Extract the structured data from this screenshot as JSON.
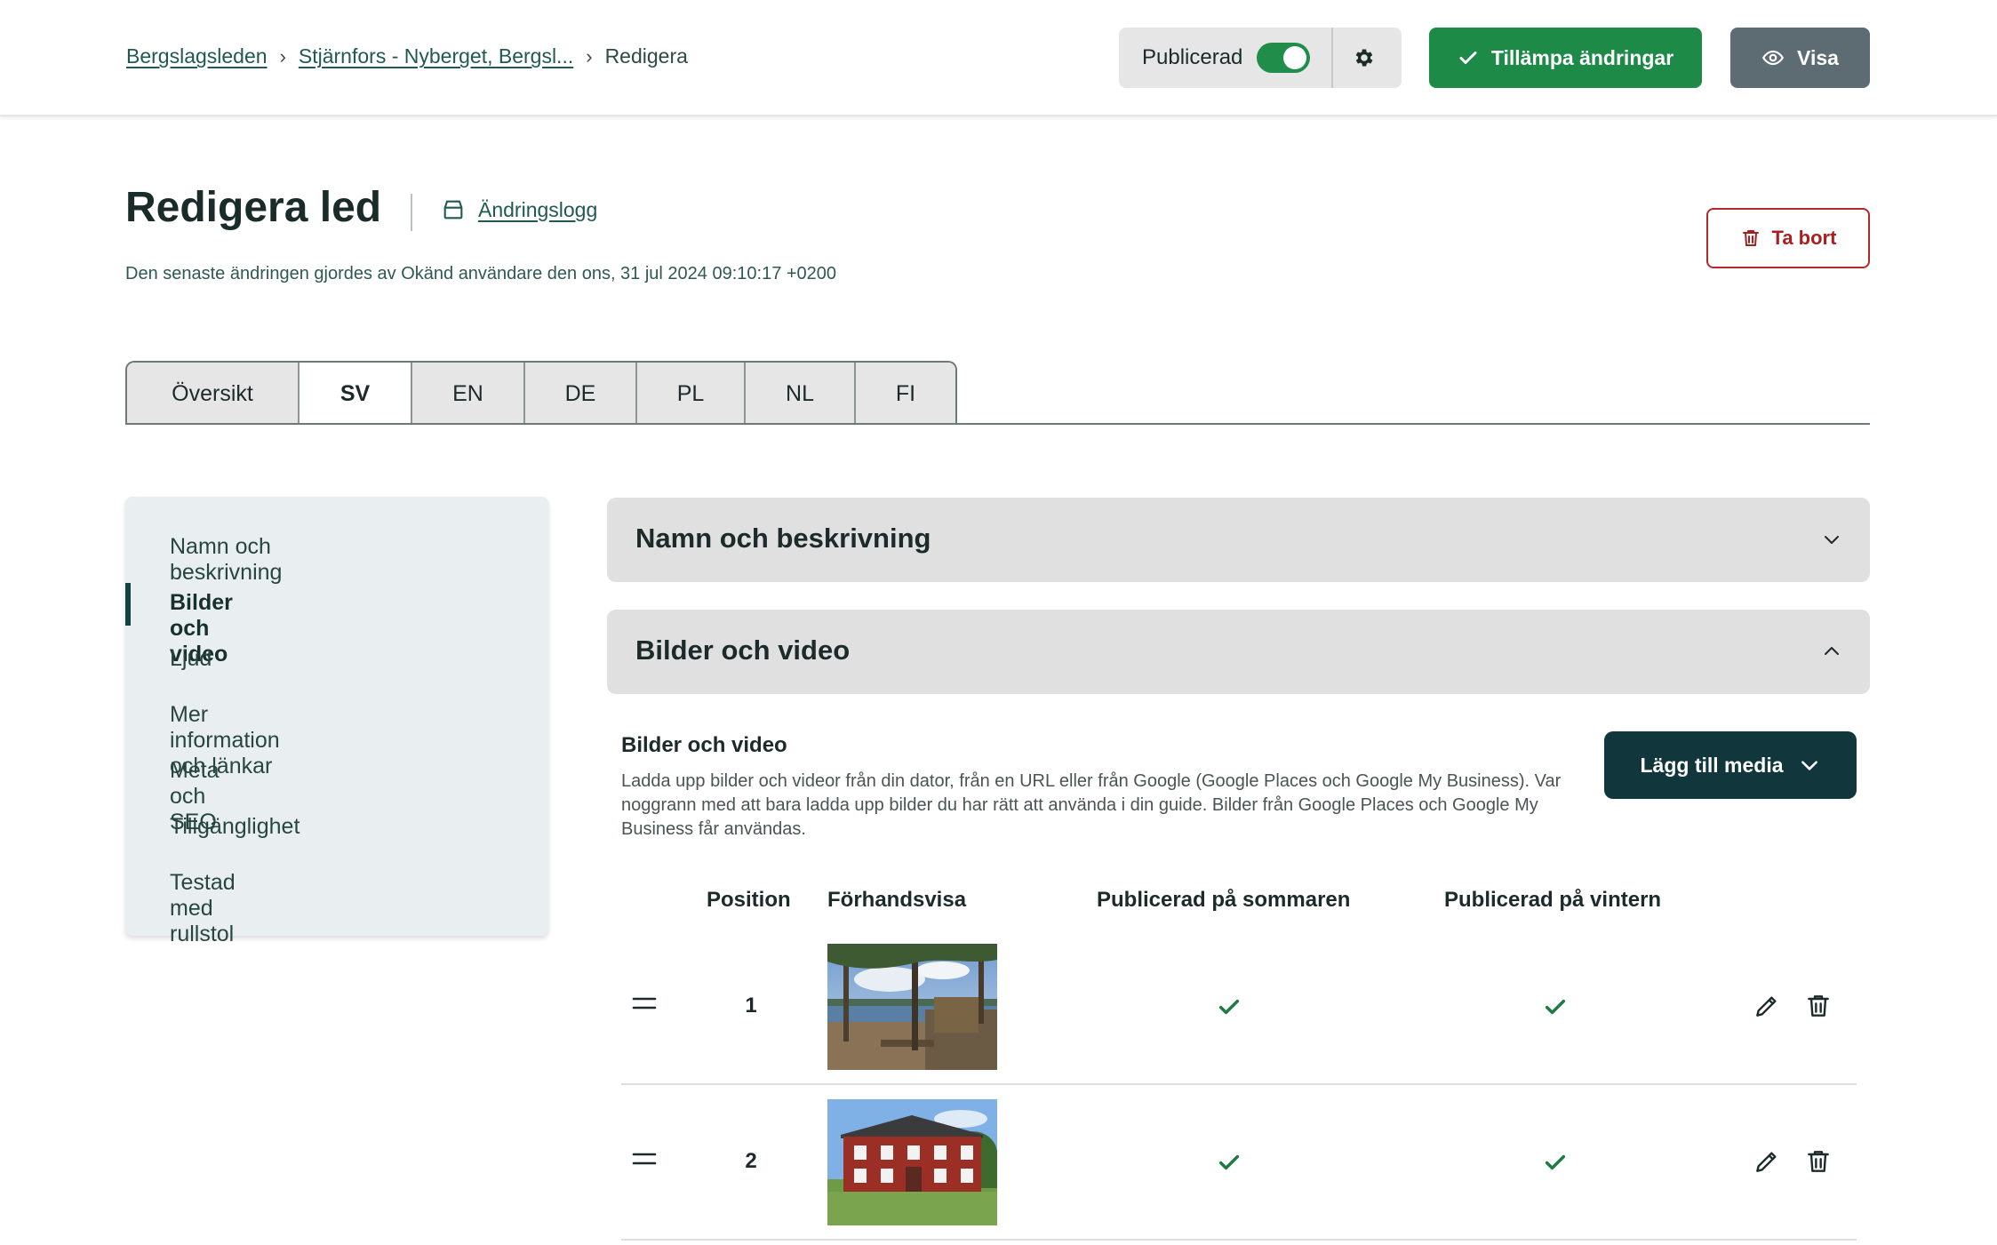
{
  "breadcrumb": {
    "items": [
      "Bergslagsleden",
      "Stjärnfors - Nyberget, Bergsl...",
      "Redigera"
    ]
  },
  "header": {
    "published_label": "Publicerad",
    "published_on": true,
    "apply_label": "Tillämpa ändringar",
    "view_label": "Visa"
  },
  "page": {
    "title": "Redigera led",
    "changelog_label": "Ändringslogg",
    "last_change": "Den senaste ändringen gjordes av Okänd användare den ons, 31 jul 2024 09:10:17 +0200",
    "delete_label": "Ta bort"
  },
  "tabs": [
    {
      "label": "Översikt",
      "active": false
    },
    {
      "label": "SV",
      "active": true
    },
    {
      "label": "EN",
      "active": false
    },
    {
      "label": "DE",
      "active": false
    },
    {
      "label": "PL",
      "active": false
    },
    {
      "label": "NL",
      "active": false
    },
    {
      "label": "FI",
      "active": false
    }
  ],
  "sidebar": {
    "items": [
      {
        "label": "Namn och beskrivning"
      },
      {
        "label": "Bilder och video",
        "active": true
      },
      {
        "label": "Ljud"
      },
      {
        "label": "Mer information och länkar"
      },
      {
        "label": "Meta och SEO"
      },
      {
        "label": "Tillgänglighet"
      },
      {
        "label": "Testad med rullstol"
      }
    ]
  },
  "sections": {
    "name_desc": {
      "title": "Namn och beskrivning",
      "expanded": false
    },
    "media": {
      "title": "Bilder och video",
      "expanded": true
    }
  },
  "media": {
    "heading": "Bilder och video",
    "description": "Ladda upp bilder och videor från din dator, från en URL eller från Google (Google Places och Google My Business). Var noggrann med att bara ladda upp bilder du har rätt att använda i din guide. Bilder från Google Places och Google My Business får användas.",
    "add_label": "Lägg till media",
    "columns": {
      "position": "Position",
      "preview": "Förhandsvisa",
      "summer": "Publicerad på sommaren",
      "winter": "Publicerad på vintern"
    },
    "rows": [
      {
        "position": "1",
        "summer": true,
        "winter": true,
        "preview": "lake-shore-photo"
      },
      {
        "position": "2",
        "summer": true,
        "winter": true,
        "preview": "red-house-photo"
      }
    ]
  },
  "colors": {
    "brand_green": "#1e8a48",
    "dark_teal": "#11373c",
    "danger": "#a81f1f",
    "check_green": "#1f7a44"
  }
}
